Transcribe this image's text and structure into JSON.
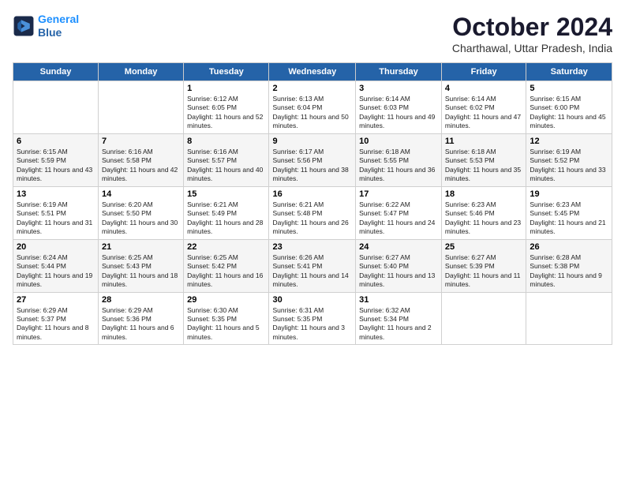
{
  "logo": {
    "line1": "General",
    "line2": "Blue"
  },
  "title": "October 2024",
  "subtitle": "Charthawal, Uttar Pradesh, India",
  "days_header": [
    "Sunday",
    "Monday",
    "Tuesday",
    "Wednesday",
    "Thursday",
    "Friday",
    "Saturday"
  ],
  "weeks": [
    [
      {
        "day": "",
        "info": ""
      },
      {
        "day": "",
        "info": ""
      },
      {
        "day": "1",
        "info": "Sunrise: 6:12 AM\nSunset: 6:05 PM\nDaylight: 11 hours and 52 minutes."
      },
      {
        "day": "2",
        "info": "Sunrise: 6:13 AM\nSunset: 6:04 PM\nDaylight: 11 hours and 50 minutes."
      },
      {
        "day": "3",
        "info": "Sunrise: 6:14 AM\nSunset: 6:03 PM\nDaylight: 11 hours and 49 minutes."
      },
      {
        "day": "4",
        "info": "Sunrise: 6:14 AM\nSunset: 6:02 PM\nDaylight: 11 hours and 47 minutes."
      },
      {
        "day": "5",
        "info": "Sunrise: 6:15 AM\nSunset: 6:00 PM\nDaylight: 11 hours and 45 minutes."
      }
    ],
    [
      {
        "day": "6",
        "info": "Sunrise: 6:15 AM\nSunset: 5:59 PM\nDaylight: 11 hours and 43 minutes."
      },
      {
        "day": "7",
        "info": "Sunrise: 6:16 AM\nSunset: 5:58 PM\nDaylight: 11 hours and 42 minutes."
      },
      {
        "day": "8",
        "info": "Sunrise: 6:16 AM\nSunset: 5:57 PM\nDaylight: 11 hours and 40 minutes."
      },
      {
        "day": "9",
        "info": "Sunrise: 6:17 AM\nSunset: 5:56 PM\nDaylight: 11 hours and 38 minutes."
      },
      {
        "day": "10",
        "info": "Sunrise: 6:18 AM\nSunset: 5:55 PM\nDaylight: 11 hours and 36 minutes."
      },
      {
        "day": "11",
        "info": "Sunrise: 6:18 AM\nSunset: 5:53 PM\nDaylight: 11 hours and 35 minutes."
      },
      {
        "day": "12",
        "info": "Sunrise: 6:19 AM\nSunset: 5:52 PM\nDaylight: 11 hours and 33 minutes."
      }
    ],
    [
      {
        "day": "13",
        "info": "Sunrise: 6:19 AM\nSunset: 5:51 PM\nDaylight: 11 hours and 31 minutes."
      },
      {
        "day": "14",
        "info": "Sunrise: 6:20 AM\nSunset: 5:50 PM\nDaylight: 11 hours and 30 minutes."
      },
      {
        "day": "15",
        "info": "Sunrise: 6:21 AM\nSunset: 5:49 PM\nDaylight: 11 hours and 28 minutes."
      },
      {
        "day": "16",
        "info": "Sunrise: 6:21 AM\nSunset: 5:48 PM\nDaylight: 11 hours and 26 minutes."
      },
      {
        "day": "17",
        "info": "Sunrise: 6:22 AM\nSunset: 5:47 PM\nDaylight: 11 hours and 24 minutes."
      },
      {
        "day": "18",
        "info": "Sunrise: 6:23 AM\nSunset: 5:46 PM\nDaylight: 11 hours and 23 minutes."
      },
      {
        "day": "19",
        "info": "Sunrise: 6:23 AM\nSunset: 5:45 PM\nDaylight: 11 hours and 21 minutes."
      }
    ],
    [
      {
        "day": "20",
        "info": "Sunrise: 6:24 AM\nSunset: 5:44 PM\nDaylight: 11 hours and 19 minutes."
      },
      {
        "day": "21",
        "info": "Sunrise: 6:25 AM\nSunset: 5:43 PM\nDaylight: 11 hours and 18 minutes."
      },
      {
        "day": "22",
        "info": "Sunrise: 6:25 AM\nSunset: 5:42 PM\nDaylight: 11 hours and 16 minutes."
      },
      {
        "day": "23",
        "info": "Sunrise: 6:26 AM\nSunset: 5:41 PM\nDaylight: 11 hours and 14 minutes."
      },
      {
        "day": "24",
        "info": "Sunrise: 6:27 AM\nSunset: 5:40 PM\nDaylight: 11 hours and 13 minutes."
      },
      {
        "day": "25",
        "info": "Sunrise: 6:27 AM\nSunset: 5:39 PM\nDaylight: 11 hours and 11 minutes."
      },
      {
        "day": "26",
        "info": "Sunrise: 6:28 AM\nSunset: 5:38 PM\nDaylight: 11 hours and 9 minutes."
      }
    ],
    [
      {
        "day": "27",
        "info": "Sunrise: 6:29 AM\nSunset: 5:37 PM\nDaylight: 11 hours and 8 minutes."
      },
      {
        "day": "28",
        "info": "Sunrise: 6:29 AM\nSunset: 5:36 PM\nDaylight: 11 hours and 6 minutes."
      },
      {
        "day": "29",
        "info": "Sunrise: 6:30 AM\nSunset: 5:35 PM\nDaylight: 11 hours and 5 minutes."
      },
      {
        "day": "30",
        "info": "Sunrise: 6:31 AM\nSunset: 5:35 PM\nDaylight: 11 hours and 3 minutes."
      },
      {
        "day": "31",
        "info": "Sunrise: 6:32 AM\nSunset: 5:34 PM\nDaylight: 11 hours and 2 minutes."
      },
      {
        "day": "",
        "info": ""
      },
      {
        "day": "",
        "info": ""
      }
    ]
  ]
}
